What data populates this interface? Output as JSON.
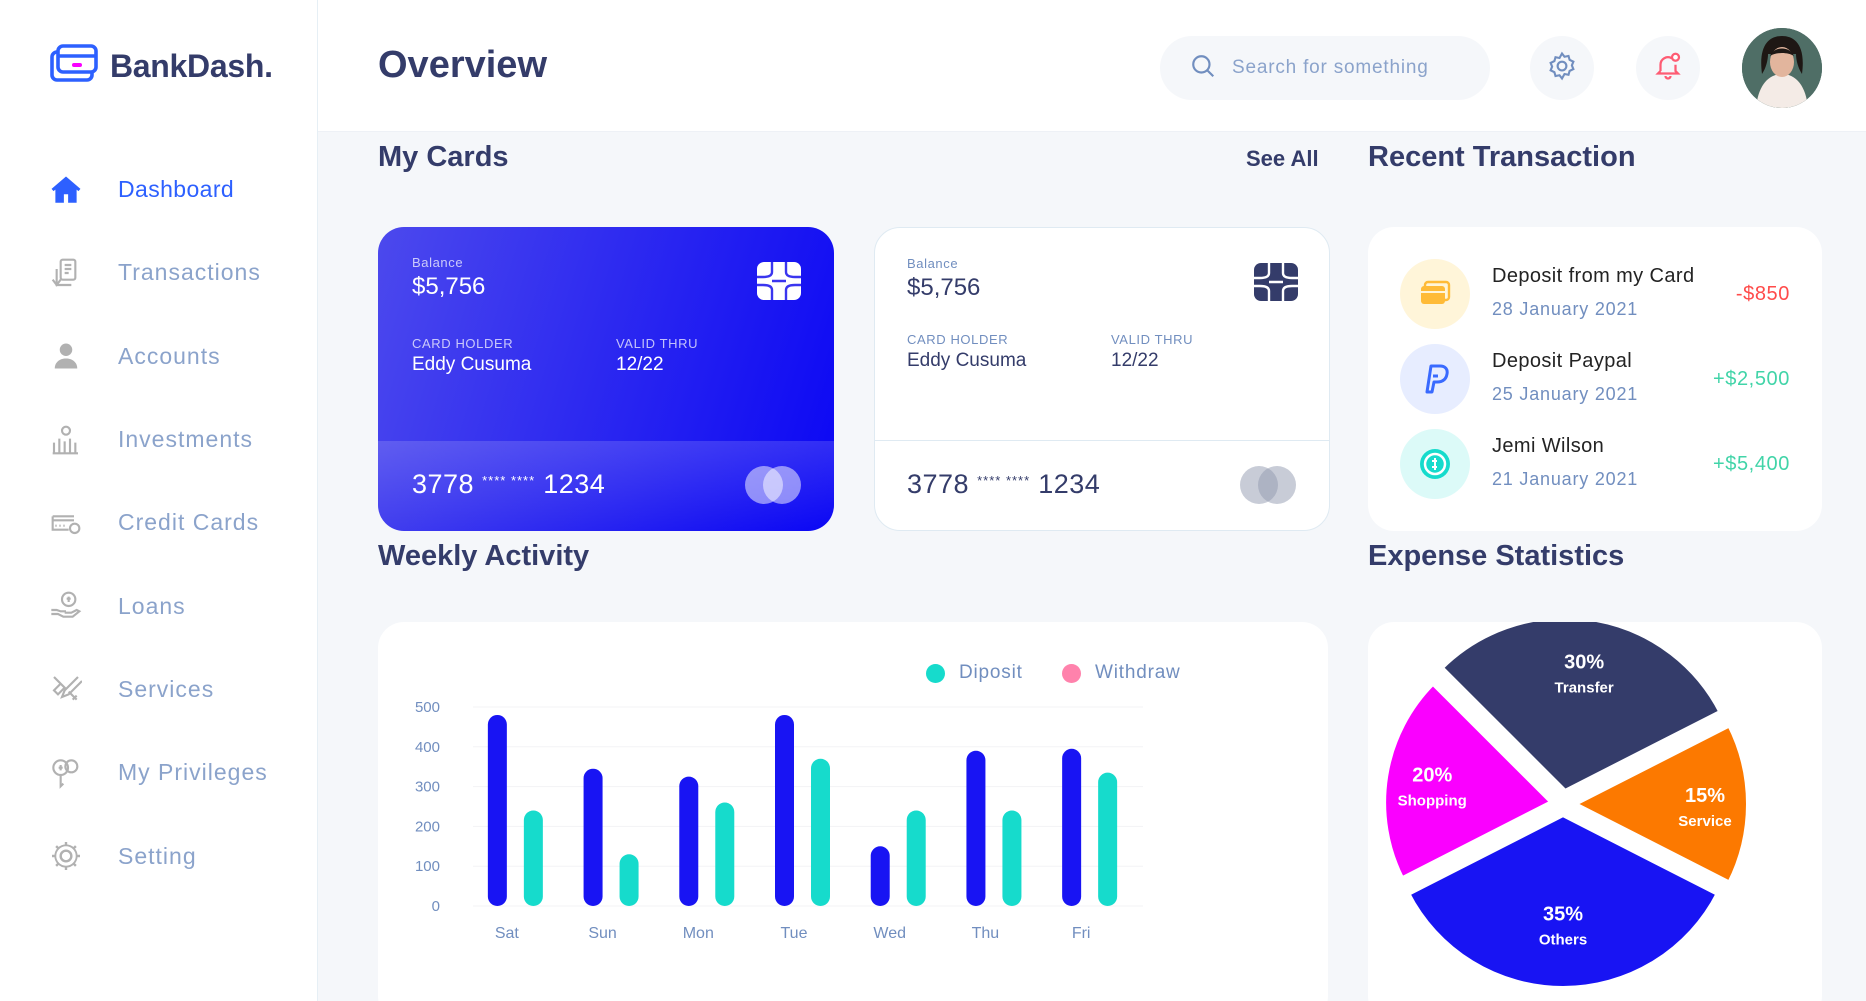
{
  "app": {
    "name": "BankDash."
  },
  "header": {
    "title": "Overview",
    "search_placeholder": "Search for something"
  },
  "sidebar": {
    "items": [
      {
        "label": "Dashboard",
        "icon": "home-icon",
        "active": true
      },
      {
        "label": "Transactions",
        "icon": "transfer-icon"
      },
      {
        "label": "Accounts",
        "icon": "user-icon"
      },
      {
        "label": "Investments",
        "icon": "investment-icon"
      },
      {
        "label": "Credit Cards",
        "icon": "credit-card-icon"
      },
      {
        "label": "Loans",
        "icon": "loan-icon"
      },
      {
        "label": "Services",
        "icon": "service-icon"
      },
      {
        "label": "My Privileges",
        "icon": "privilege-icon"
      },
      {
        "label": "Setting",
        "icon": "settings-icon"
      }
    ]
  },
  "cards_section": {
    "title": "My Cards",
    "see_all": "See All"
  },
  "cards": [
    {
      "balance_label": "Balance",
      "balance": "$5,756",
      "holder_label": "CARD HOLDER",
      "holder": "Eddy Cusuma",
      "valid_label": "VALID THRU",
      "valid": "12/22",
      "number_start": "3778",
      "number_mask": "**** ****",
      "number_end": "1234"
    },
    {
      "balance_label": "Balance",
      "balance": "$5,756",
      "holder_label": "CARD HOLDER",
      "holder": "Eddy Cusuma",
      "valid_label": "VALID THRU",
      "valid": "12/22",
      "number_start": "3778",
      "number_mask": "**** ****",
      "number_end": "1234"
    }
  ],
  "transactions": {
    "title": "Recent Transaction",
    "items": [
      {
        "title": "Deposit from my Card",
        "date": "28 January 2021",
        "amount": "-$850",
        "icon": "card-icon",
        "amount_color": "#ff4b4a"
      },
      {
        "title": "Deposit Paypal",
        "date": "25 January 2021",
        "amount": "+$2,500",
        "icon": "paypal-icon",
        "amount_color": "#41d4a8"
      },
      {
        "title": "Jemi Wilson",
        "date": "21 January 2021",
        "amount": "+$5,400",
        "icon": "dollar-icon",
        "amount_color": "#41d4a8"
      }
    ]
  },
  "weekly": {
    "title": "Weekly Activity",
    "legend": {
      "deposit": "Diposit",
      "withdraw": "Withdraw"
    }
  },
  "expense": {
    "title": "Expense Statistics"
  },
  "colors": {
    "accent": "#2d60ff",
    "deposit": "#1814f3",
    "withdraw": "#16dbcc",
    "title": "#343c6a",
    "muted": "#718ebf"
  },
  "chart_data": [
    {
      "type": "bar",
      "title": "Weekly Activity",
      "categories": [
        "Sat",
        "Sun",
        "Mon",
        "Tue",
        "Wed",
        "Thu",
        "Fri"
      ],
      "series": [
        {
          "name": "Diposit",
          "values": [
            480,
            345,
            325,
            480,
            150,
            390,
            395
          ]
        },
        {
          "name": "Withdraw",
          "values": [
            240,
            130,
            260,
            370,
            240,
            240,
            335
          ]
        }
      ],
      "ylim": [
        0,
        500
      ],
      "yticks": [
        0,
        100,
        200,
        300,
        400,
        500
      ],
      "grid": true,
      "legend": "top-right"
    },
    {
      "type": "pie",
      "title": "Expense Statistics",
      "slices": [
        {
          "label": "Transfer",
          "value": 30,
          "display": "30%",
          "color": "#343c6a"
        },
        {
          "label": "Service",
          "value": 15,
          "display": "15%",
          "color": "#fc7900"
        },
        {
          "label": "Others",
          "value": 35,
          "display": "35%",
          "color": "#1814f3"
        },
        {
          "label": "Shopping",
          "value": 20,
          "display": "20%",
          "color": "#fa00ff"
        }
      ]
    }
  ]
}
